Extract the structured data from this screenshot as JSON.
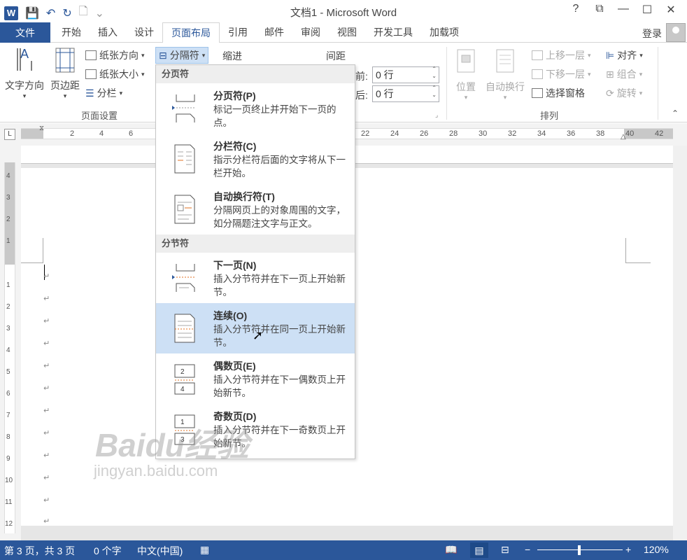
{
  "titlebar": {
    "title": "文档1 - Microsoft Word",
    "word_icon": "W",
    "qat_icons": [
      "save-icon",
      "undo-icon",
      "redo-icon",
      "new-doc-icon",
      "customize-icon"
    ],
    "help": "?",
    "ribbon_display": "⧉",
    "minimize": "—",
    "maximize": "☐",
    "close": "✕"
  },
  "tabs": {
    "file": "文件",
    "items": [
      "开始",
      "插入",
      "设计",
      "页面布局",
      "引用",
      "邮件",
      "审阅",
      "视图",
      "开发工具",
      "加载项"
    ],
    "active": "页面布局",
    "login": "登录"
  },
  "ribbon": {
    "text_direction": "文字方向",
    "margins": "页边距",
    "orientation": "纸张方向",
    "size": "纸张大小",
    "columns": "分栏",
    "breaks": "分隔符",
    "page_setup_label": "页面设置",
    "indent_label": "缩进",
    "spacing_label": "间距",
    "before_label": "前:",
    "before_value": "0 行",
    "after_label": "后:",
    "after_value": "0 行",
    "position": "位置",
    "wrap_text": "自动换行",
    "bring_forward": "上移一层",
    "send_backward": "下移一层",
    "selection_pane": "选择窗格",
    "align": "对齐",
    "group": "组合",
    "rotate": "旋转",
    "arrange_label": "排列"
  },
  "ruler": {
    "corner": "L",
    "numbers": [
      "2",
      "4",
      "6",
      "22",
      "24",
      "26",
      "28",
      "30",
      "32",
      "34",
      "36",
      "38",
      "40",
      "42"
    ]
  },
  "vruler": {
    "numbers": [
      "4",
      "3",
      "2",
      "1",
      "1",
      "2",
      "3",
      "4",
      "5",
      "6",
      "7",
      "8",
      "9",
      "10",
      "11",
      "12"
    ]
  },
  "document": {
    "paragraph_mark": "↵"
  },
  "menu": {
    "page_breaks_header": "分页符",
    "section_breaks_header": "分节符",
    "items": [
      {
        "title": "分页符(P)",
        "desc": "标记一页终止并开始下一页的点。"
      },
      {
        "title": "分栏符(C)",
        "desc": "指示分栏符后面的文字将从下一栏开始。"
      },
      {
        "title": "自动换行符(T)",
        "desc": "分隔网页上的对象周围的文字，如分隔题注文字与正文。"
      },
      {
        "title": "下一页(N)",
        "desc": "插入分节符并在下一页上开始新节。"
      },
      {
        "title": "连续(O)",
        "desc": "插入分节符并在同一页上开始新节。"
      },
      {
        "title": "偶数页(E)",
        "desc": "插入分节符并在下一偶数页上开始新节。"
      },
      {
        "title": "奇数页(D)",
        "desc": "插入分节符并在下一奇数页上开始新节。"
      }
    ]
  },
  "statusbar": {
    "page": "第 3 页，共 3 页",
    "words": "0 个字",
    "language": "中文(中国)",
    "zoom": "120%"
  },
  "watermark": {
    "text": "Baidu经验",
    "url": "jingyan.baidu.com"
  }
}
